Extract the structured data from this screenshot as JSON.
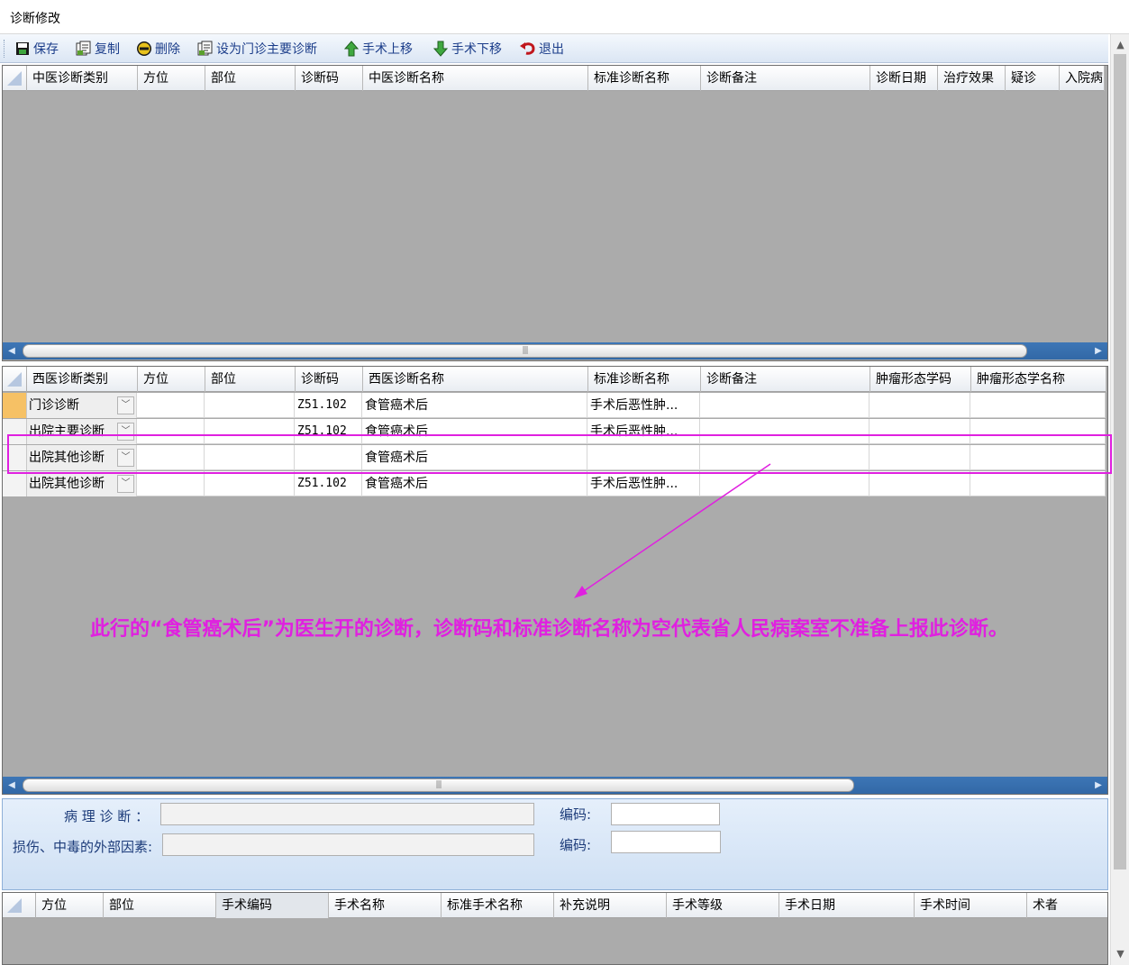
{
  "window": {
    "title": "诊断修改"
  },
  "toolbar": {
    "save": "保存",
    "copy": "复制",
    "delete": "删除",
    "set_main": "设为门诊主要诊断",
    "move_up": "手术上移",
    "move_down": "手术下移",
    "exit": "退出"
  },
  "tcm_grid": {
    "headers": [
      "中医诊断类别",
      "方位",
      "部位",
      "诊断码",
      "中医诊断名称",
      "标准诊断名称",
      "诊断备注",
      "诊断日期",
      "治疗效果",
      "疑诊",
      "入院病"
    ]
  },
  "wm_grid": {
    "headers": [
      "西医诊断类别",
      "方位",
      "部位",
      "诊断码",
      "西医诊断名称",
      "标准诊断名称",
      "诊断备注",
      "肿瘤形态学码",
      "肿瘤形态学名称"
    ],
    "rows": [
      {
        "category": "门诊诊断",
        "position": "",
        "site": "",
        "code": "Z51.102",
        "name": "食管癌术后",
        "standard": "手术后恶性肿...",
        "note": "",
        "morph_code": "",
        "morph_name": ""
      },
      {
        "category": "出院主要诊断",
        "position": "",
        "site": "",
        "code": "Z51.102",
        "name": "食管癌术后",
        "standard": "手术后恶性肿...",
        "note": "",
        "morph_code": "",
        "morph_name": ""
      },
      {
        "category": "出院其他诊断",
        "position": "",
        "site": "",
        "code": "",
        "name": "食管癌术后",
        "standard": "",
        "note": "",
        "morph_code": "",
        "morph_name": ""
      },
      {
        "category": "出院其他诊断",
        "position": "",
        "site": "",
        "code": "Z51.102",
        "name": "食管癌术后",
        "standard": "手术后恶性肿...",
        "note": "",
        "morph_code": "",
        "morph_name": ""
      }
    ]
  },
  "annotation": {
    "text": "此行的“食管癌术后”为医生开的诊断，诊断码和标准诊断名称为空代表省人民病案室不准备上报此诊断。"
  },
  "form": {
    "pathology_label": "病 理 诊 断 ：",
    "pathology_value": "",
    "pathology_code_label": "编码:",
    "pathology_code": "",
    "injury_label": "损伤、中毒的外部因素:",
    "injury_value": "",
    "injury_code_label": "编码:",
    "injury_code": ""
  },
  "surgery_grid": {
    "headers": [
      "方位",
      "部位",
      "手术编码",
      "手术名称",
      "标准手术名称",
      "补充说明",
      "手术等级",
      "手术日期",
      "手术时间",
      "术者"
    ]
  },
  "colors": {
    "highlight": "#e020e0",
    "grid_background": "#ababab",
    "scrollbar": "#3d76b6",
    "selected_row_header": "#f6c165"
  }
}
